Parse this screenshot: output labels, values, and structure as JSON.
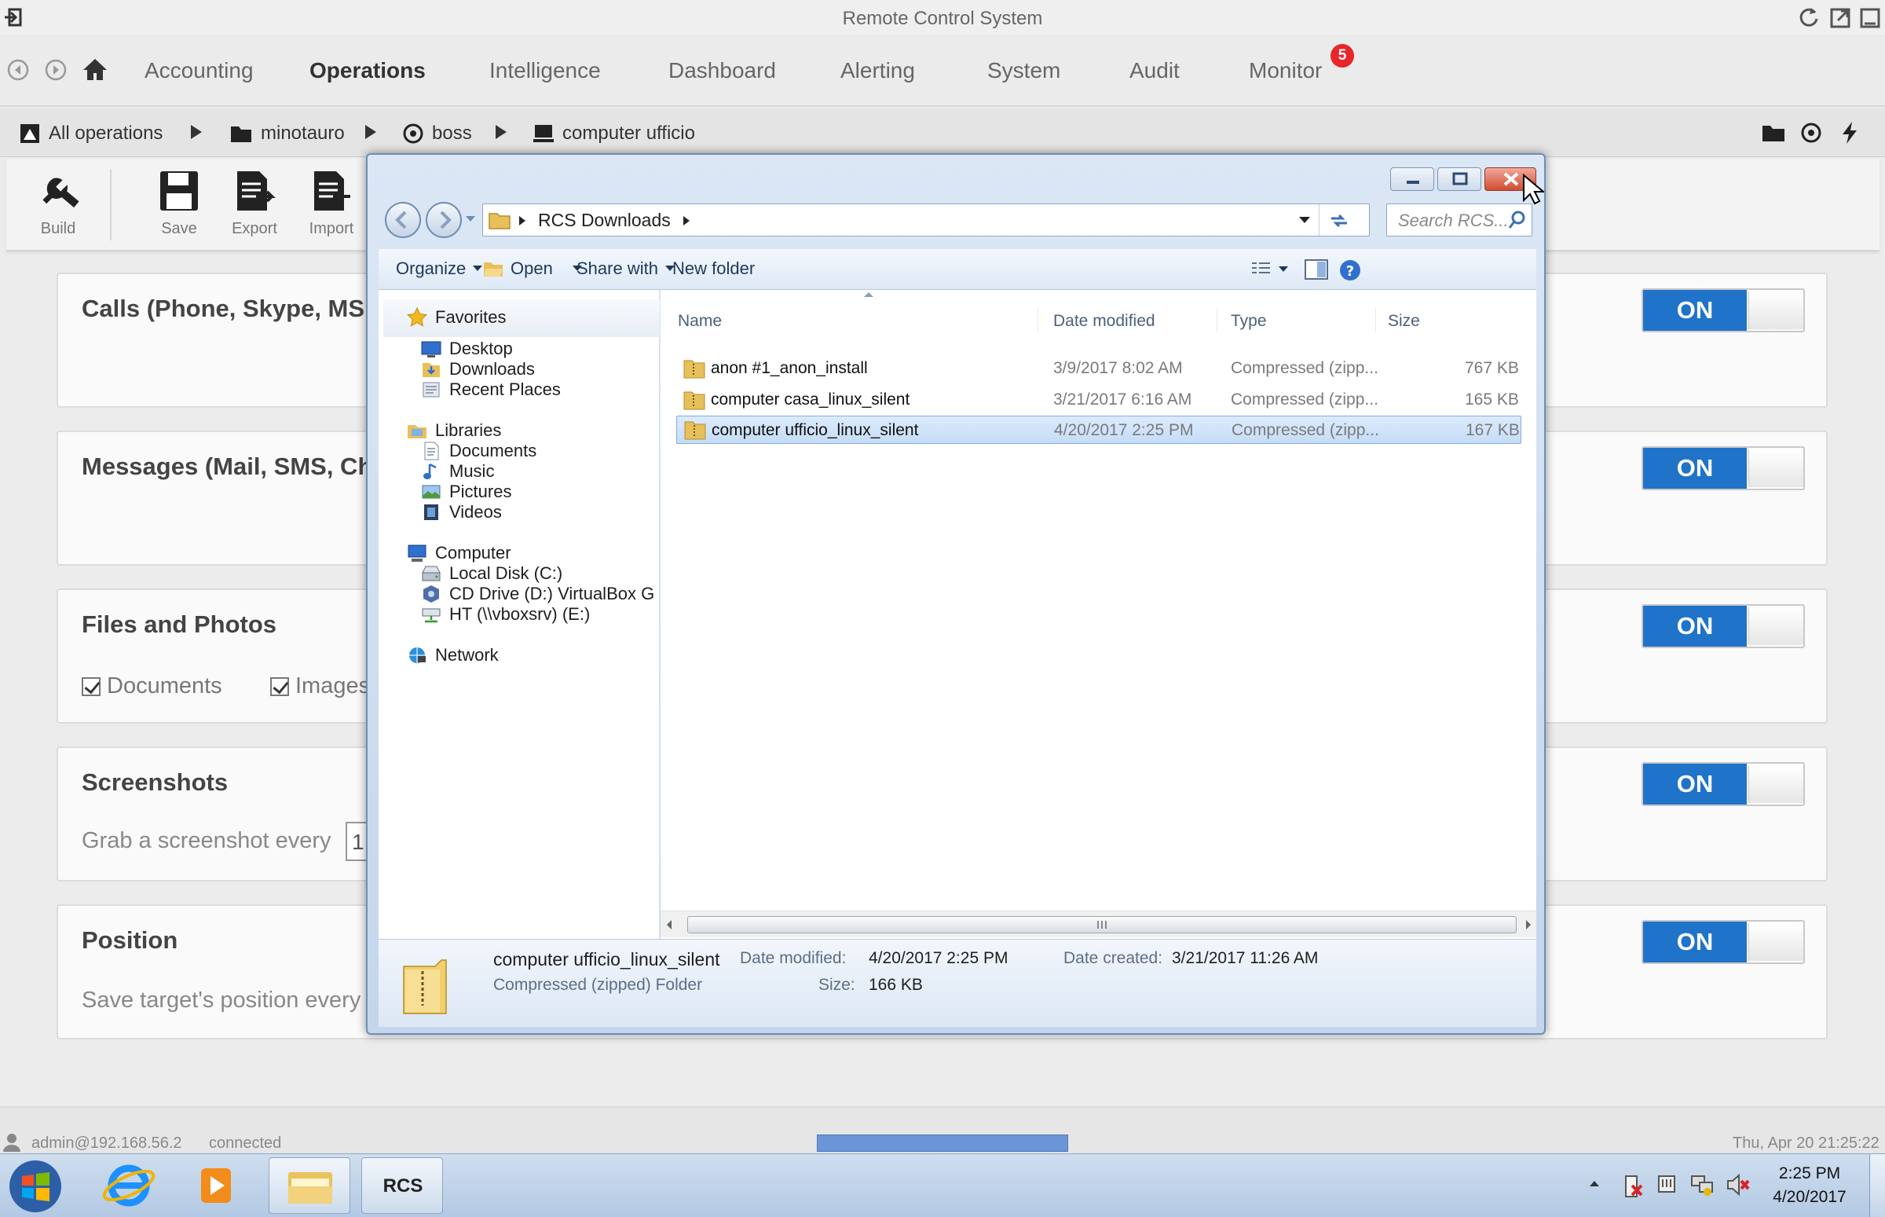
{
  "app": {
    "title": "Remote Control System"
  },
  "nav": {
    "items": [
      {
        "label": "Accounting",
        "active": false
      },
      {
        "label": "Operations",
        "active": true
      },
      {
        "label": "Intelligence",
        "active": false
      },
      {
        "label": "Dashboard",
        "active": false
      },
      {
        "label": "Alerting",
        "active": false
      },
      {
        "label": "System",
        "active": false
      },
      {
        "label": "Audit",
        "active": false
      },
      {
        "label": "Monitor",
        "active": false
      }
    ],
    "monitor_badge": "5"
  },
  "breadcrumb": {
    "items": [
      "All operations",
      "minotauro",
      "boss",
      "computer ufficio"
    ]
  },
  "toolbar": {
    "build": "Build",
    "save": "Save",
    "export": "Export",
    "import": "Import"
  },
  "panels": [
    {
      "title": "Calls (Phone, Skype, MSN",
      "toggle": "ON"
    },
    {
      "title": "Messages (Mail, SMS, Ch",
      "toggle": "ON"
    },
    {
      "title": "Files and Photos",
      "toggle": "ON",
      "checks": [
        "Documents",
        "Images"
      ]
    },
    {
      "title": "Screenshots",
      "subtitle": "Grab a screenshot every",
      "input_value": "1",
      "toggle": "ON"
    },
    {
      "title": "Position",
      "subtitle": "Save target's position every",
      "toggle": "ON"
    }
  ],
  "statusbar": {
    "user": "admin@192.168.56.2",
    "state": "connected",
    "datetime": "Thu, Apr 20  21:25:22"
  },
  "explorer": {
    "path": [
      "RCS Downloads"
    ],
    "search_placeholder": "Search RCS...",
    "commands": {
      "organize": "Organize",
      "open": "Open",
      "share": "Share with",
      "new_folder": "New folder"
    },
    "nav": {
      "favorites": "Favorites",
      "fav_items": [
        "Desktop",
        "Downloads",
        "Recent Places"
      ],
      "libraries": "Libraries",
      "lib_items": [
        "Documents",
        "Music",
        "Pictures",
        "Videos"
      ],
      "computer": "Computer",
      "comp_items": [
        "Local Disk (C:)",
        "CD Drive (D:) VirtualBox G",
        "HT (\\\\vboxsrv) (E:)"
      ],
      "network": "Network"
    },
    "columns": {
      "name": "Name",
      "date": "Date modified",
      "type": "Type",
      "size": "Size"
    },
    "files": [
      {
        "name": "anon #1_anon_install",
        "date": "3/9/2017 8:02 AM",
        "type": "Compressed (zipp...",
        "size": "767 KB",
        "selected": false
      },
      {
        "name": "computer casa_linux_silent",
        "date": "3/21/2017 6:16 AM",
        "type": "Compressed (zipp...",
        "size": "165 KB",
        "selected": false
      },
      {
        "name": "computer ufficio_linux_silent",
        "date": "4/20/2017 2:25 PM",
        "type": "Compressed (zipp...",
        "size": "167 KB",
        "selected": true
      }
    ],
    "details": {
      "name": "computer ufficio_linux_silent",
      "type": "Compressed (zipped) Folder",
      "date_modified_label": "Date modified:",
      "date_modified": "4/20/2017 2:25 PM",
      "size_label": "Size:",
      "size": "166 KB",
      "date_created_label": "Date created:",
      "date_created": "3/21/2017 11:26 AM"
    }
  },
  "taskbar": {
    "rcs_label": "RCS",
    "time": "2:25 PM",
    "date": "4/20/2017"
  },
  "colors": {
    "accent": "#1f73c8",
    "badge": "#e8262a",
    "selection": "#c5dcf7"
  }
}
